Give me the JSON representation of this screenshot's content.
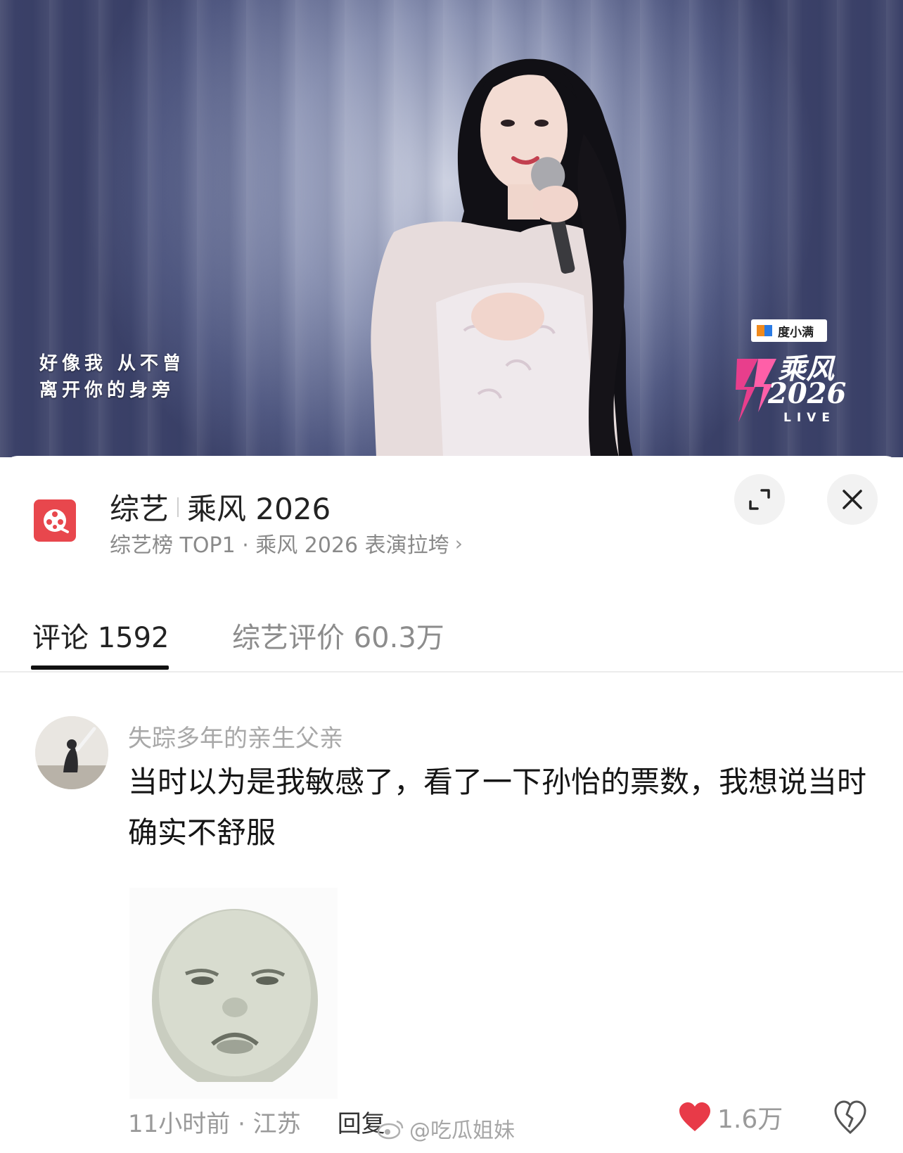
{
  "video": {
    "subtitle_line1": "好像我  从不曾",
    "subtitle_line2": "离开你的身旁",
    "sponsor_label": "度小满",
    "show_logo_title": "乘风",
    "show_logo_year": "2026",
    "show_logo_live": "LIVE"
  },
  "header": {
    "category": "综艺",
    "title": "乘风 2026",
    "subtitle": "综艺榜 TOP1 · 乘风 2026 表演拉垮",
    "expand_icon": "expand-icon",
    "close_icon": "close-icon"
  },
  "tabs": [
    {
      "label": "评论 1592",
      "active": true
    },
    {
      "label": "综艺评价 60.3万",
      "active": false
    }
  ],
  "comment": {
    "username": "失踪多年的亲生父亲",
    "text": "当时以为是我敏感了，看了一下孙怡的票数，我想说当时确实不舒服",
    "time_location": "11小时前 · 江苏",
    "reply_label": "回复",
    "like_count": "1.6万"
  },
  "watermark": "@吃瓜姐妹",
  "colors": {
    "accent_red": "#e8474d",
    "like_red": "#e83a48",
    "text_primary": "#222222",
    "text_secondary": "#8a8a8a"
  }
}
